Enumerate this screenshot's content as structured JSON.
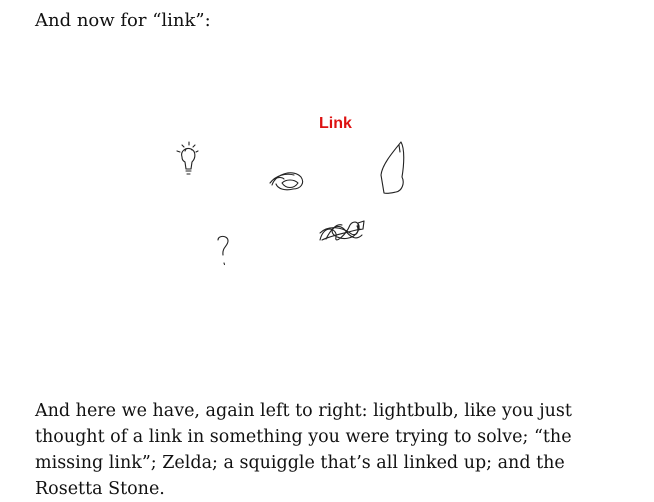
{
  "intro": "And now for “link”:",
  "figure": {
    "label": "Link",
    "label_color": "#dd1111",
    "sketches": [
      "lightbulb-icon",
      "question-mark-icon",
      "missing-link-sketch-icon",
      "zelda-sketch-icon",
      "squiggle-sketch-icon",
      "rosetta-stone-sketch-icon"
    ]
  },
  "caption": "And here we have, again left to right: lightbulb, like you just thought of a link in something you were trying to solve; “the missing link”; Zelda; a squiggle that’s all linked up; and the Rosetta Stone."
}
